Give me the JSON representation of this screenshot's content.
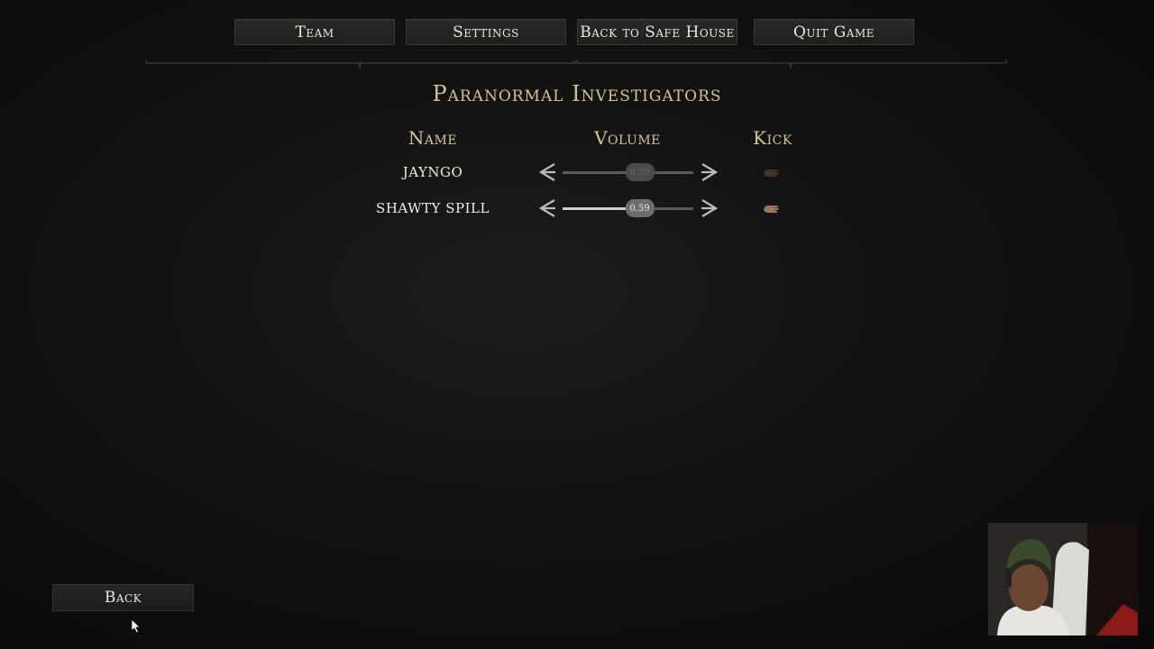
{
  "menu": {
    "team": "Team",
    "settings": "Settings",
    "back_to_safe_house": "Back to Safe House",
    "quit_game": "Quit Game"
  },
  "title": "Paranormal Investigators",
  "columns": {
    "name": "Name",
    "volume": "Volume",
    "kick": "Kick"
  },
  "players": [
    {
      "name": "JAYNGO",
      "volume": 0.59,
      "volume_label": "0.59",
      "enabled": false
    },
    {
      "name": "SHAWTY SPILL",
      "volume": 0.59,
      "volume_label": "0.59",
      "enabled": true
    }
  ],
  "back": "Back",
  "icons": {
    "left": "chevron-left-icon",
    "right": "chevron-right-icon",
    "kick": "kick-hand-icon"
  },
  "colors": {
    "title_gold": "#d9c18f",
    "header_tan": "#d4c3a2",
    "background": "#121211"
  }
}
